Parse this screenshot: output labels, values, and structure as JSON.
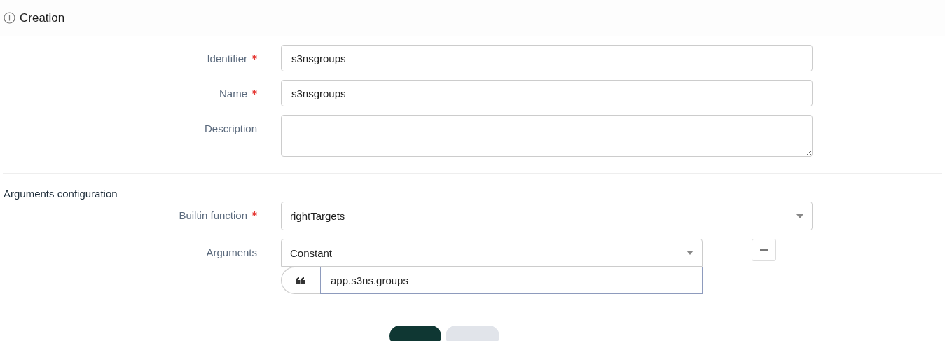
{
  "header": {
    "title": "Creation"
  },
  "fields": [
    {
      "label": "Identifier",
      "required": true,
      "kind": "text",
      "value": "s3nsgroups"
    },
    {
      "label": "Name",
      "required": true,
      "kind": "text",
      "value": "s3nsgroups"
    },
    {
      "label": "Description",
      "required": false,
      "kind": "textarea"
    }
  ],
  "section": {
    "title": "Arguments configuration"
  },
  "builtin_function": {
    "label": "Builtin function",
    "required": true,
    "value": "rightTargets"
  },
  "arguments": {
    "label": "Arguments",
    "type": "Constant",
    "value": "app.s3ns.groups"
  },
  "buttons": [
    {
      "kind": "primary"
    },
    {
      "kind": "secondary"
    }
  ]
}
